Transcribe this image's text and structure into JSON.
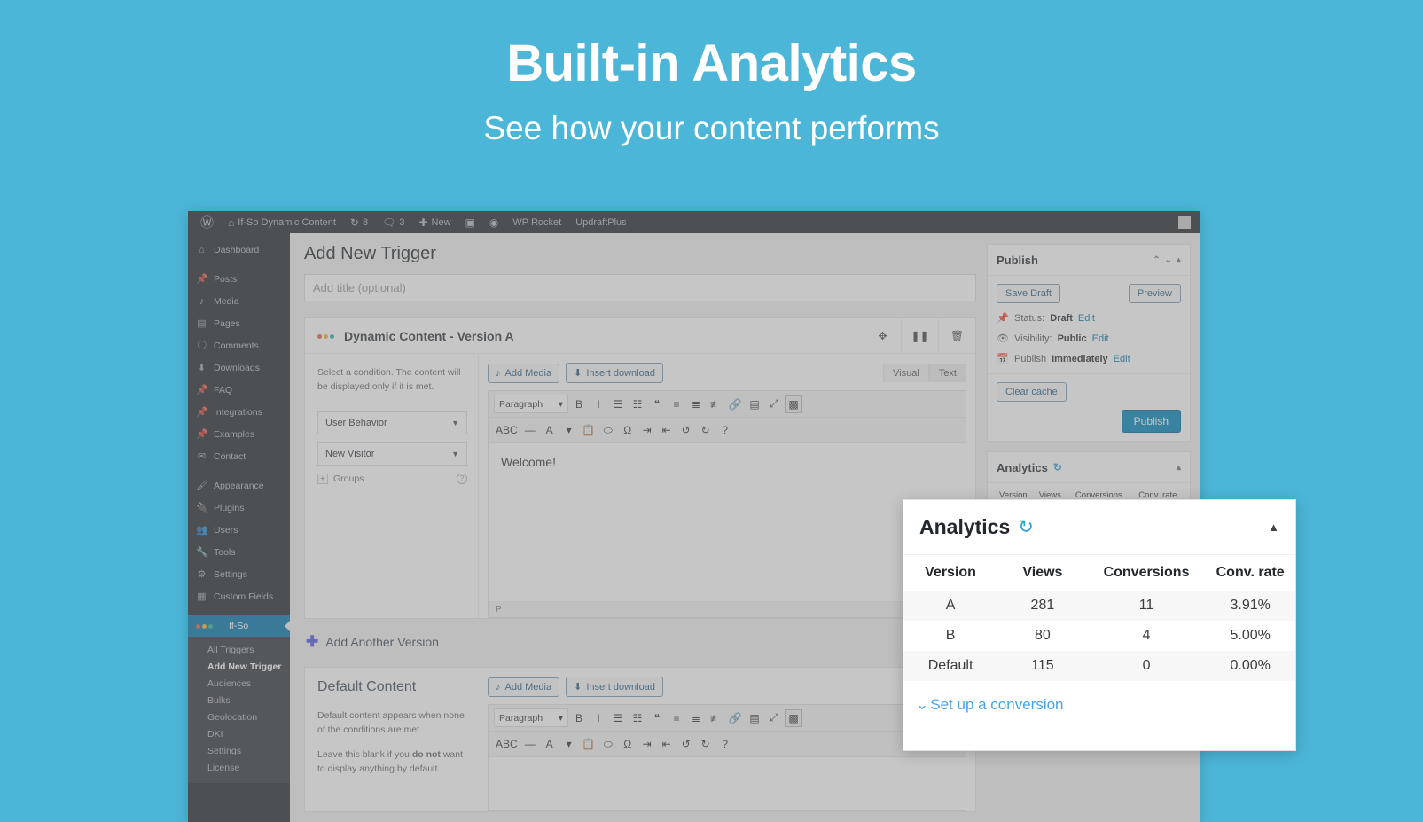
{
  "promo": {
    "title": "Built-in Analytics",
    "subtitle": "See how your content performs",
    "bg_color": "#4cb6d8"
  },
  "adminbar": {
    "logo_icon": "wordpress-icon",
    "site_name": "If-So Dynamic Content",
    "updates_count": "8",
    "comments_count": "3",
    "new_label": "New",
    "items": [
      {
        "label": "WP Rocket"
      },
      {
        "label": "UpdraftPlus"
      }
    ]
  },
  "sidebar": {
    "items": [
      {
        "label": "Dashboard",
        "icon": "dashboard-icon"
      },
      {
        "label": "Posts",
        "icon": "pin-icon"
      },
      {
        "label": "Media",
        "icon": "media-icon"
      },
      {
        "label": "Pages",
        "icon": "pages-icon"
      },
      {
        "label": "Comments",
        "icon": "comment-icon"
      },
      {
        "label": "Downloads",
        "icon": "download-icon"
      },
      {
        "label": "FAQ",
        "icon": "pin-icon"
      },
      {
        "label": "Integrations",
        "icon": "pin-icon"
      },
      {
        "label": "Examples",
        "icon": "pin-icon"
      },
      {
        "label": "Contact",
        "icon": "mail-icon"
      },
      {
        "label": "Appearance",
        "icon": "brush-icon"
      },
      {
        "label": "Plugins",
        "icon": "plug-icon"
      },
      {
        "label": "Users",
        "icon": "users-icon"
      },
      {
        "label": "Tools",
        "icon": "tools-icon"
      },
      {
        "label": "Settings",
        "icon": "settings-icon"
      },
      {
        "label": "Custom Fields",
        "icon": "grid-icon"
      }
    ],
    "current": {
      "label": "If-So",
      "icon": "ifso-dots-icon"
    },
    "submenu": [
      {
        "label": "All Triggers",
        "active": false
      },
      {
        "label": "Add New Trigger",
        "active": true
      },
      {
        "label": "Audiences",
        "active": false
      },
      {
        "label": "Bulks",
        "active": false
      },
      {
        "label": "Geolocation",
        "active": false
      },
      {
        "label": "DKI",
        "active": false
      },
      {
        "label": "Settings",
        "active": false
      },
      {
        "label": "License",
        "active": false
      }
    ]
  },
  "editor": {
    "page_title": "Add New Trigger",
    "title_placeholder": "Add title (optional)",
    "version": {
      "heading": "Dynamic Content - Version A",
      "actions": [
        {
          "name": "move-handle",
          "glyph": "✥"
        },
        {
          "name": "pause-button",
          "glyph": "❚❚"
        },
        {
          "name": "delete-button",
          "glyph": "🗑"
        }
      ],
      "condition_help": "Select a condition. The content will be displayed only if it is met.",
      "condition_type": "User Behavior",
      "condition_value": "New Visitor",
      "groups_label": "Groups"
    },
    "toolbar": {
      "add_media": "Add Media",
      "insert_download": "Insert download",
      "tab_visual": "Visual",
      "tab_text": "Text",
      "format_select": "Paragraph",
      "row1": [
        "B",
        "I",
        "☰",
        "☷",
        "❝",
        "≡",
        "≣",
        "≢",
        "🔗",
        "▤",
        "⤢",
        "▩"
      ],
      "row2": [
        "ABC",
        "—",
        "A",
        "▾",
        "📋",
        "⬭",
        "Ω",
        "⇥",
        "⇤",
        "↺",
        "↻",
        "?"
      ]
    },
    "content": "Welcome!",
    "status_path": "P",
    "add_version": "Add Another Version",
    "default_section": {
      "title": "Default Content",
      "help_1": "Default content appears when none of the conditions are met.",
      "help_2_a": "Leave this blank if you ",
      "help_2_b": "do not",
      "help_2_c": " want to display anything by default."
    }
  },
  "publish_panel": {
    "title": "Publish",
    "save_draft": "Save Draft",
    "preview": "Preview",
    "status_label": "Status:",
    "status_value": "Draft",
    "status_edit": "Edit",
    "visibility_label": "Visibility:",
    "visibility_value": "Public",
    "visibility_edit": "Edit",
    "publish_label": "Publish",
    "publish_value": "Immediately",
    "publish_edit": "Edit",
    "clear_cache": "Clear cache",
    "publish_button": "Publish",
    "accent_color": "#0085ba"
  },
  "analytics_panel": {
    "title": "Analytics",
    "refresh_icon": "refresh-icon",
    "collapse_icon": "caret-up-icon",
    "columns": [
      "Version",
      "Views",
      "Conversions",
      "Conv. rate"
    ],
    "rows": [
      {
        "version": "A",
        "views": "281",
        "conversions": "11",
        "rate": "3.91%"
      },
      {
        "version": "B",
        "views": "80",
        "conversions": "4",
        "rate": "5.00%"
      },
      {
        "version": "Default",
        "views": "115",
        "conversions": "0",
        "rate": "0.00%"
      }
    ],
    "link": "Set up a conversion",
    "link_color": "#4aa3dd"
  },
  "chart_data": {
    "type": "table",
    "title": "Analytics",
    "columns": [
      "Version",
      "Views",
      "Conversions",
      "Conv. rate"
    ],
    "rows": [
      [
        "A",
        281,
        11,
        "3.91%"
      ],
      [
        "B",
        80,
        4,
        "5.00%"
      ],
      [
        "Default",
        115,
        0,
        "0.00%"
      ]
    ],
    "series": [
      {
        "name": "Views",
        "categories": [
          "A",
          "B",
          "Default"
        ],
        "values": [
          281,
          80,
          115
        ]
      },
      {
        "name": "Conversions",
        "categories": [
          "A",
          "B",
          "Default"
        ],
        "values": [
          11,
          4,
          0
        ]
      },
      {
        "name": "Conv. rate (%)",
        "categories": [
          "A",
          "B",
          "Default"
        ],
        "values": [
          3.91,
          5.0,
          0.0
        ]
      }
    ]
  }
}
